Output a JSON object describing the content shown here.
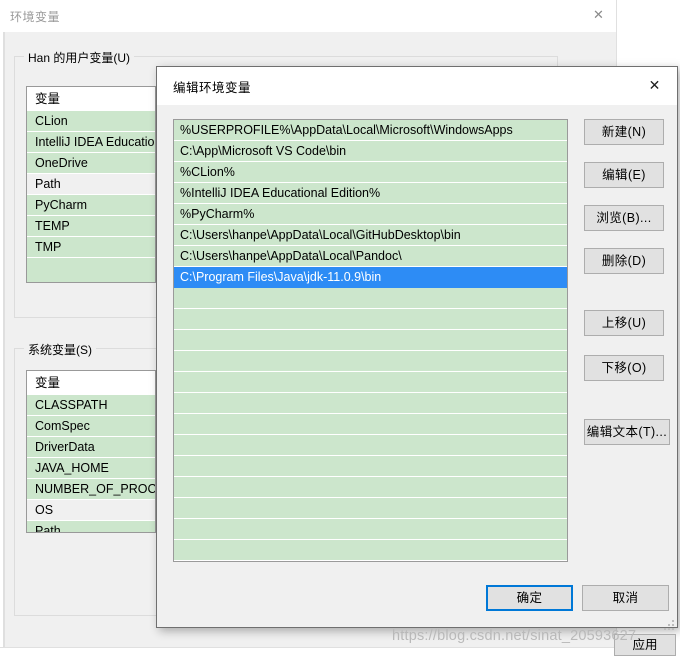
{
  "background_window": {
    "title": "环境变量",
    "close_icon": "close-icon",
    "user_group": {
      "legend": "Han 的用户变量(U)",
      "column_header": "变量",
      "rows": [
        {
          "name": "CLion",
          "selected": false
        },
        {
          "name": "IntelliJ IDEA Educatio",
          "selected": false
        },
        {
          "name": "OneDrive",
          "selected": false
        },
        {
          "name": "Path",
          "selected": true
        },
        {
          "name": "PyCharm",
          "selected": false
        },
        {
          "name": "TEMP",
          "selected": false
        },
        {
          "name": "TMP",
          "selected": false
        }
      ]
    },
    "system_group": {
      "legend": "系统变量(S)",
      "column_header": "变量",
      "rows": [
        {
          "name": "CLASSPATH",
          "selected": false
        },
        {
          "name": "ComSpec",
          "selected": false
        },
        {
          "name": "DriverData",
          "selected": false
        },
        {
          "name": "JAVA_HOME",
          "selected": false
        },
        {
          "name": "NUMBER_OF_PROCES",
          "selected": false
        },
        {
          "name": "OS",
          "selected": true
        },
        {
          "name": "Path",
          "selected": false
        }
      ]
    },
    "apply_button": "应用"
  },
  "dialog": {
    "title": "编辑环境变量",
    "close_icon": "close-icon",
    "path_entries": [
      {
        "value": "%USERPROFILE%\\AppData\\Local\\Microsoft\\WindowsApps",
        "selected": false
      },
      {
        "value": "C:\\App\\Microsoft VS Code\\bin",
        "selected": false
      },
      {
        "value": "%CLion%",
        "selected": false
      },
      {
        "value": "%IntelliJ IDEA Educational Edition%",
        "selected": false
      },
      {
        "value": "%PyCharm%",
        "selected": false
      },
      {
        "value": "C:\\Users\\hanpe\\AppData\\Local\\GitHubDesktop\\bin",
        "selected": false
      },
      {
        "value": "C:\\Users\\hanpe\\AppData\\Local\\Pandoc\\",
        "selected": false
      },
      {
        "value": "C:\\Program Files\\Java\\jdk-11.0.9\\bin",
        "selected": true
      }
    ],
    "blank_row_count": 13,
    "buttons": {
      "new": "新建(N)",
      "edit": "编辑(E)",
      "browse": "浏览(B)...",
      "delete": "删除(D)",
      "move_up": "上移(U)",
      "move_down": "下移(O)",
      "edit_text": "编辑文本(T)...",
      "ok": "确定",
      "cancel": "取消"
    }
  },
  "watermark": "https://blog.csdn.net/sinat_20593627",
  "colors": {
    "list_background": "#cce6cc",
    "selection_blue": "#2d8cf5",
    "focus_border": "#0078d7",
    "window_background": "#f0f0f0"
  }
}
